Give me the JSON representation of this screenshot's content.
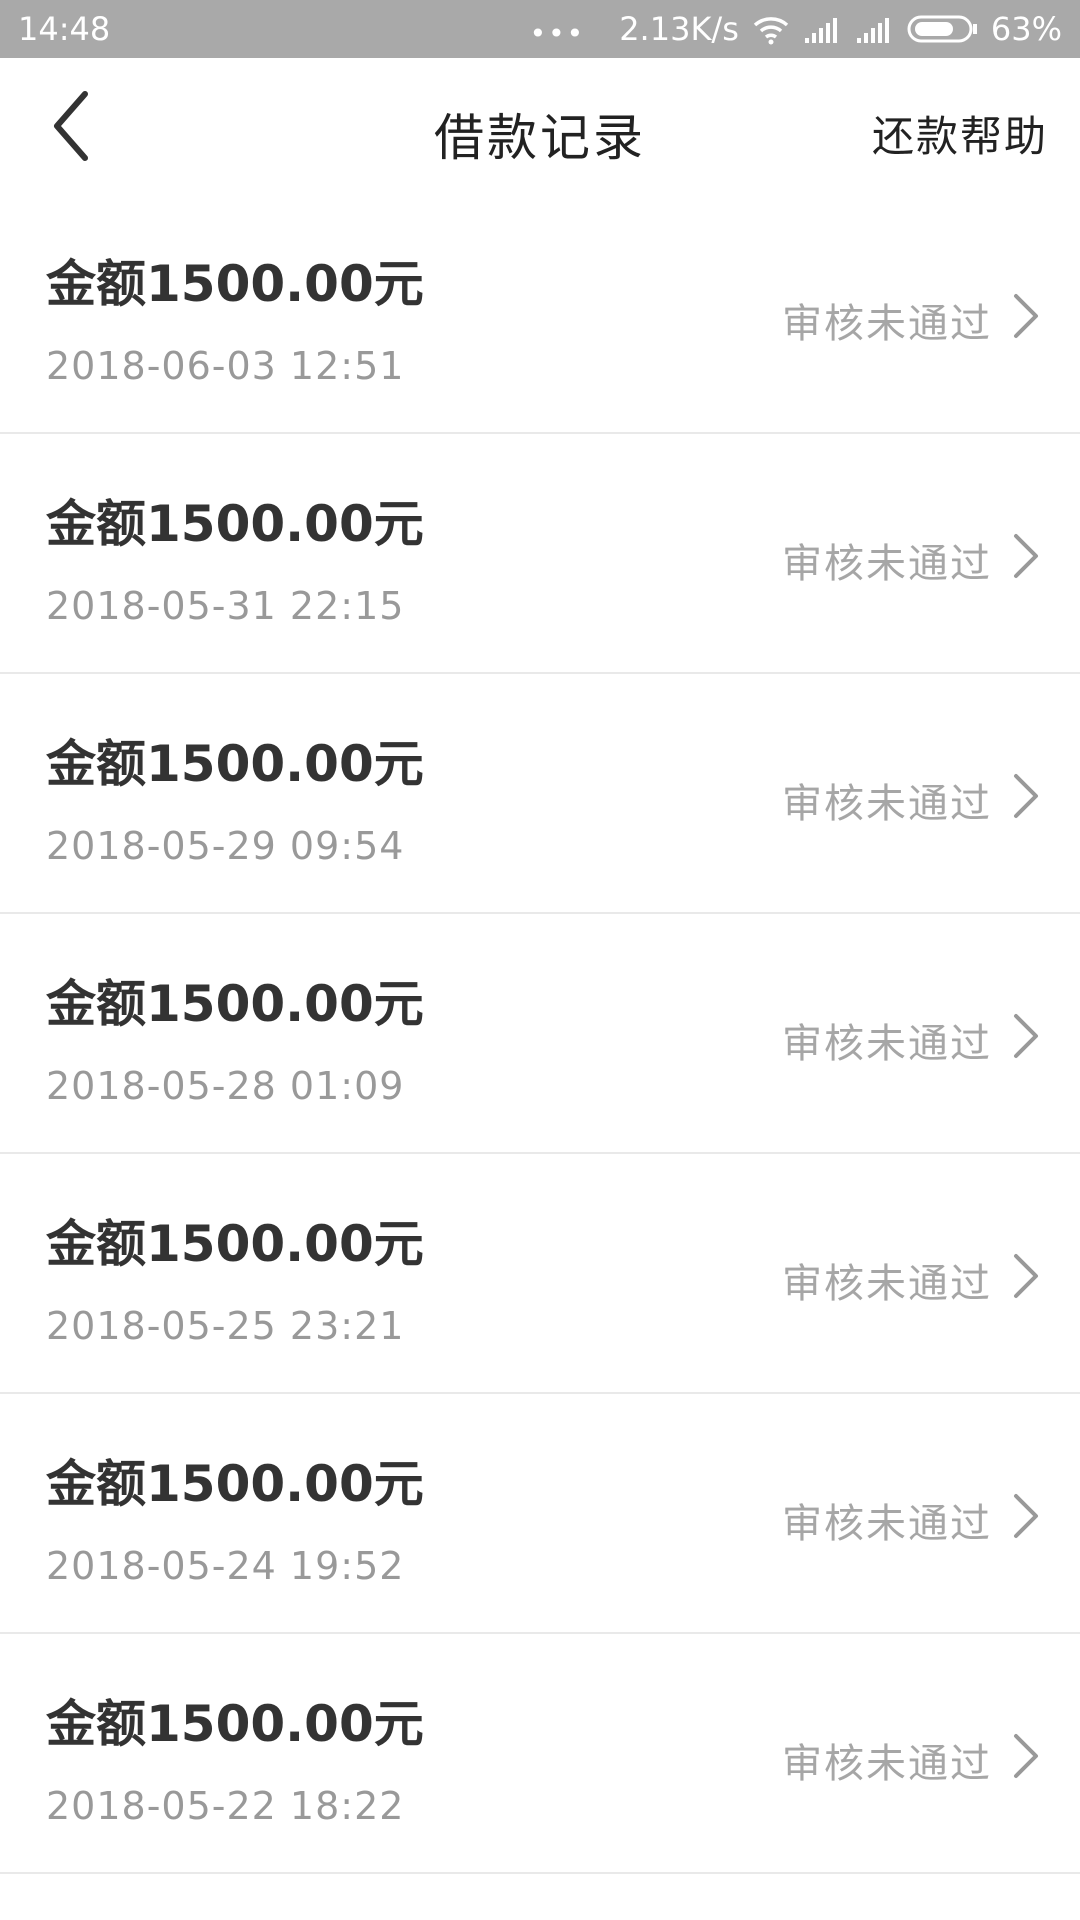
{
  "status_bar": {
    "time": "14:48",
    "dots": "•••",
    "speed": "2.13K/s",
    "battery": "63%",
    "icons": [
      "wifi-icon",
      "signal-icon",
      "signal-icon",
      "battery-icon"
    ]
  },
  "header": {
    "title": "借款记录",
    "help_label": "还款帮助",
    "back_icon": "back-arrow-icon"
  },
  "records": [
    {
      "amount": "金额1500.00元",
      "date": "2018-06-03 12:51",
      "status": "审核未通过"
    },
    {
      "amount": "金额1500.00元",
      "date": "2018-05-31 22:15",
      "status": "审核未通过"
    },
    {
      "amount": "金额1500.00元",
      "date": "2018-05-29 09:54",
      "status": "审核未通过"
    },
    {
      "amount": "金额1500.00元",
      "date": "2018-05-28 01:09",
      "status": "审核未通过"
    },
    {
      "amount": "金额1500.00元",
      "date": "2018-05-25 23:21",
      "status": "审核未通过"
    },
    {
      "amount": "金额1500.00元",
      "date": "2018-05-24 19:52",
      "status": "审核未通过"
    },
    {
      "amount": "金额1500.00元",
      "date": "2018-05-22 18:22",
      "status": "审核未通过"
    }
  ],
  "colors": {
    "status_bar_bg": "#a9a9a9",
    "title_text": "#222222",
    "amount_text": "#333333",
    "date_text": "#999999",
    "status_text": "#a6a6a6",
    "divider": "#e9e9e9"
  }
}
